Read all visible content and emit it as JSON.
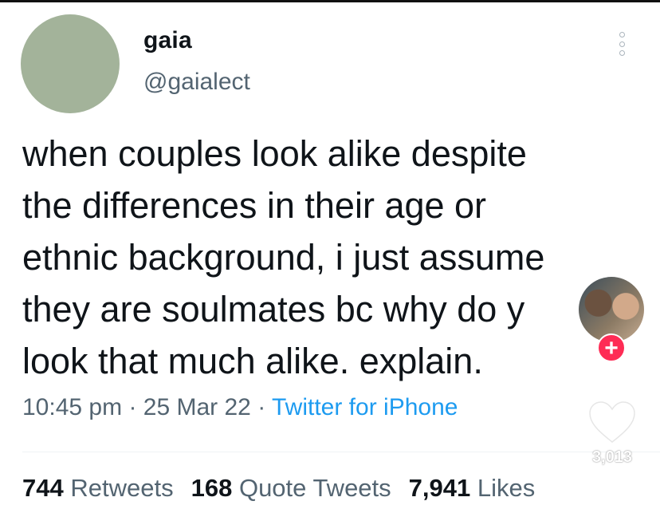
{
  "tweet": {
    "display_name": "gaia",
    "handle": "@gaialect",
    "avatar_color": "#a3b39a",
    "text_lines": [
      "when couples look alike despite",
      "the differences in their age or",
      "ethnic background, i just assume",
      "they are soulmates bc why do y",
      "look that much alike. explain."
    ],
    "time": "10:45 pm",
    "separator": "·",
    "date": "25 Mar 22",
    "source": "Twitter for iPhone",
    "source_color": "#1d9bf0",
    "stats": {
      "retweets_count": "744",
      "retweets_label": "Retweets",
      "quotes_count": "168",
      "quotes_label": "Quote Tweets",
      "likes_count": "7,941",
      "likes_label": "Likes"
    }
  },
  "overlay": {
    "follow_label": "+",
    "follow_color": "#fe2c55",
    "like_count": "3,013",
    "heart_icon": "heart-icon",
    "more_icon": "more-options-icon"
  }
}
